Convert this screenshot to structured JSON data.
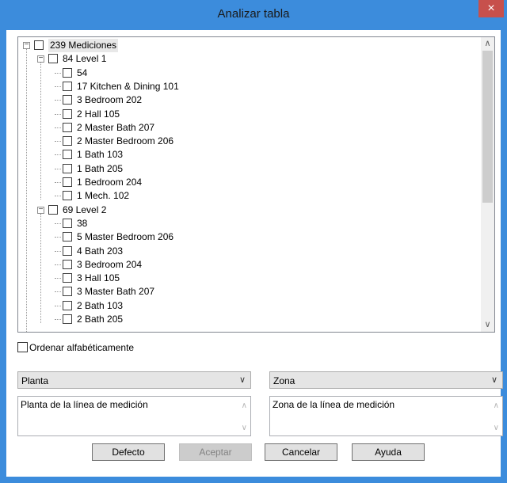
{
  "window": {
    "title": "Analizar tabla",
    "close_glyph": "×"
  },
  "tree": {
    "root": {
      "label": "239 Mediciones"
    },
    "groups": [
      {
        "label": "84 Level 1",
        "items": [
          "54",
          "17 Kitchen & Dining 101",
          "3 Bedroom 202",
          "2 Hall 105",
          "2 Master Bath 207",
          "2 Master Bedroom 206",
          "1 Bath 103",
          "1 Bath 205",
          "1 Bedroom 204",
          "1 Mech. 102"
        ]
      },
      {
        "label": "69 Level 2",
        "items": [
          "38",
          "5 Master Bedroom 206",
          "4 Bath 203",
          "3 Bedroom 204",
          "3 Hall 105",
          "3 Master Bath 207",
          "2 Bath 103",
          "2 Bath 205"
        ]
      }
    ],
    "expander_glyph": "−"
  },
  "sort": {
    "label": "Ordenar alfabéticamente"
  },
  "combos": {
    "left": "Planta",
    "right": "Zona",
    "arrow": "∨"
  },
  "memos": {
    "left": "Planta de la línea de medición",
    "right": "Zona de la línea de medición",
    "up": "∧",
    "down": "∨"
  },
  "buttons": {
    "default": "Defecto",
    "accept": "Aceptar",
    "cancel": "Cancelar",
    "help": "Ayuda"
  },
  "scroll": {
    "up": "∧",
    "down": "∨"
  }
}
